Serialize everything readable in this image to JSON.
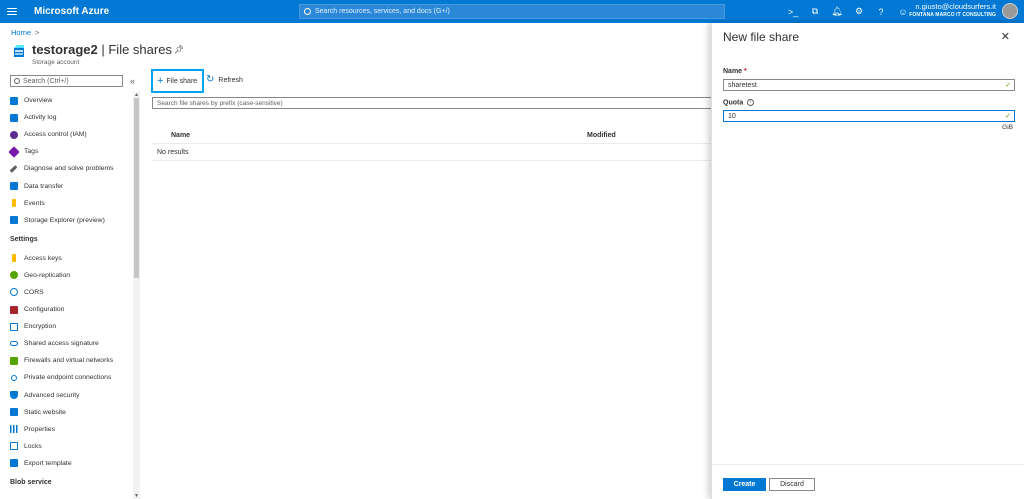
{
  "topbar": {
    "brand": "Microsoft Azure",
    "search_placeholder": "Search resources, services, and docs (G+/)",
    "user_email": "n.giusto@cloudsurfers.it",
    "user_org": "FONTANA MARCO IT CONSULTING",
    "icons": [
      "cloud-shell-icon",
      "directory-filter-icon",
      "notifications-icon",
      "settings-icon",
      "help-icon",
      "feedback-icon"
    ],
    "color": "#0078d4"
  },
  "breadcrumb": {
    "home": "Home",
    "separator": ">"
  },
  "page": {
    "resource_name": "testorage2",
    "separator": " | ",
    "blade_name": "File shares",
    "subtitle": "Storage account"
  },
  "left_nav": {
    "search_placeholder": "Search (Ctrl+/)",
    "collapse_glyph": "«",
    "items": [
      {
        "label": "Overview",
        "color": "#0078d4"
      },
      {
        "label": "Activity log",
        "color": "#0078d4"
      },
      {
        "label": "Access control (IAM)",
        "color": "#5c2d91"
      },
      {
        "label": "Tags",
        "color": "#7719aa"
      },
      {
        "label": "Diagnose and solve problems",
        "color": "#605e5c"
      },
      {
        "label": "Data transfer",
        "color": "#0078d4"
      },
      {
        "label": "Events",
        "color": "#ffb900"
      },
      {
        "label": "Storage Explorer (preview)",
        "color": "#0078d4"
      }
    ],
    "settings_header": "Settings",
    "settings_items": [
      {
        "label": "Access keys",
        "color": "#ffb900"
      },
      {
        "label": "Geo-replication",
        "color": "#57a300"
      },
      {
        "label": "CORS",
        "color": "#0078d4"
      },
      {
        "label": "Configuration",
        "color": "#a4262c"
      },
      {
        "label": "Encryption",
        "color": "#0078d4"
      },
      {
        "label": "Shared access signature",
        "color": "#0078d4"
      },
      {
        "label": "Firewalls and virtual networks",
        "color": "#57a300"
      },
      {
        "label": "Private endpoint connections",
        "color": "#0078d4"
      },
      {
        "label": "Advanced security",
        "color": "#0078d4"
      },
      {
        "label": "Static website",
        "color": "#0078d4"
      },
      {
        "label": "Properties",
        "color": "#0078d4"
      },
      {
        "label": "Locks",
        "color": "#0078d4"
      },
      {
        "label": "Export template",
        "color": "#0078d4"
      }
    ],
    "blob_header": "Blob service"
  },
  "toolbar": {
    "add_label": "File share",
    "refresh_label": "Refresh"
  },
  "filter": {
    "placeholder": "Search file shares by prefix (case-sensitive)"
  },
  "grid": {
    "columns": [
      "Name",
      "Modified"
    ],
    "empty_text": "No results"
  },
  "new_share_blade": {
    "title": "New file share",
    "close_glyph": "✕",
    "name_label": "Name",
    "required_marker": "*",
    "name_value": "sharetest",
    "quota_label": "Quota",
    "quota_value": "10",
    "quota_unit": "GiB",
    "create_label": "Create",
    "discard_label": "Discard"
  }
}
